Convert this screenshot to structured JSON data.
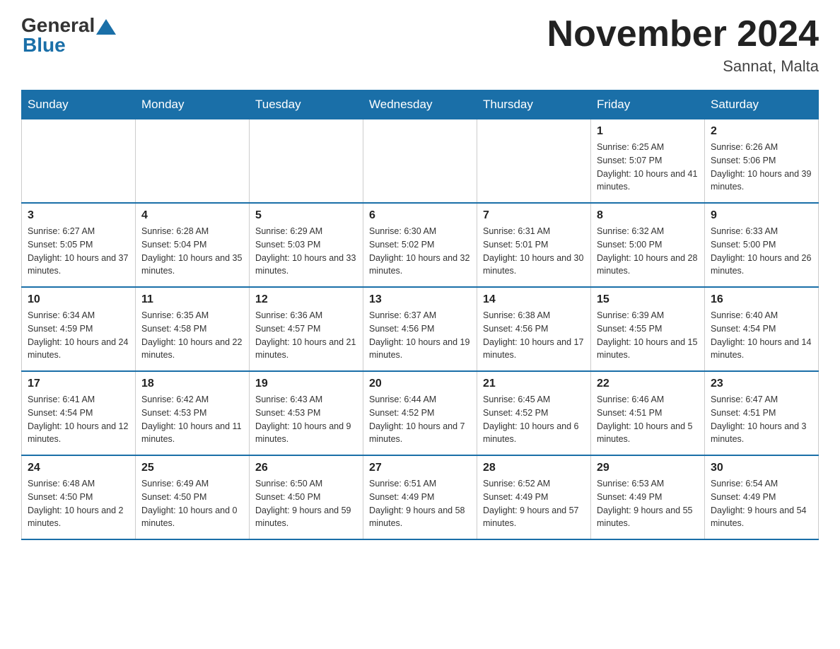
{
  "header": {
    "logo_general": "General",
    "logo_blue": "Blue",
    "title": "November 2024",
    "subtitle": "Sannat, Malta"
  },
  "days_of_week": [
    "Sunday",
    "Monday",
    "Tuesday",
    "Wednesday",
    "Thursday",
    "Friday",
    "Saturday"
  ],
  "weeks": [
    [
      {
        "day": "",
        "info": ""
      },
      {
        "day": "",
        "info": ""
      },
      {
        "day": "",
        "info": ""
      },
      {
        "day": "",
        "info": ""
      },
      {
        "day": "",
        "info": ""
      },
      {
        "day": "1",
        "info": "Sunrise: 6:25 AM\nSunset: 5:07 PM\nDaylight: 10 hours and 41 minutes."
      },
      {
        "day": "2",
        "info": "Sunrise: 6:26 AM\nSunset: 5:06 PM\nDaylight: 10 hours and 39 minutes."
      }
    ],
    [
      {
        "day": "3",
        "info": "Sunrise: 6:27 AM\nSunset: 5:05 PM\nDaylight: 10 hours and 37 minutes."
      },
      {
        "day": "4",
        "info": "Sunrise: 6:28 AM\nSunset: 5:04 PM\nDaylight: 10 hours and 35 minutes."
      },
      {
        "day": "5",
        "info": "Sunrise: 6:29 AM\nSunset: 5:03 PM\nDaylight: 10 hours and 33 minutes."
      },
      {
        "day": "6",
        "info": "Sunrise: 6:30 AM\nSunset: 5:02 PM\nDaylight: 10 hours and 32 minutes."
      },
      {
        "day": "7",
        "info": "Sunrise: 6:31 AM\nSunset: 5:01 PM\nDaylight: 10 hours and 30 minutes."
      },
      {
        "day": "8",
        "info": "Sunrise: 6:32 AM\nSunset: 5:00 PM\nDaylight: 10 hours and 28 minutes."
      },
      {
        "day": "9",
        "info": "Sunrise: 6:33 AM\nSunset: 5:00 PM\nDaylight: 10 hours and 26 minutes."
      }
    ],
    [
      {
        "day": "10",
        "info": "Sunrise: 6:34 AM\nSunset: 4:59 PM\nDaylight: 10 hours and 24 minutes."
      },
      {
        "day": "11",
        "info": "Sunrise: 6:35 AM\nSunset: 4:58 PM\nDaylight: 10 hours and 22 minutes."
      },
      {
        "day": "12",
        "info": "Sunrise: 6:36 AM\nSunset: 4:57 PM\nDaylight: 10 hours and 21 minutes."
      },
      {
        "day": "13",
        "info": "Sunrise: 6:37 AM\nSunset: 4:56 PM\nDaylight: 10 hours and 19 minutes."
      },
      {
        "day": "14",
        "info": "Sunrise: 6:38 AM\nSunset: 4:56 PM\nDaylight: 10 hours and 17 minutes."
      },
      {
        "day": "15",
        "info": "Sunrise: 6:39 AM\nSunset: 4:55 PM\nDaylight: 10 hours and 15 minutes."
      },
      {
        "day": "16",
        "info": "Sunrise: 6:40 AM\nSunset: 4:54 PM\nDaylight: 10 hours and 14 minutes."
      }
    ],
    [
      {
        "day": "17",
        "info": "Sunrise: 6:41 AM\nSunset: 4:54 PM\nDaylight: 10 hours and 12 minutes."
      },
      {
        "day": "18",
        "info": "Sunrise: 6:42 AM\nSunset: 4:53 PM\nDaylight: 10 hours and 11 minutes."
      },
      {
        "day": "19",
        "info": "Sunrise: 6:43 AM\nSunset: 4:53 PM\nDaylight: 10 hours and 9 minutes."
      },
      {
        "day": "20",
        "info": "Sunrise: 6:44 AM\nSunset: 4:52 PM\nDaylight: 10 hours and 7 minutes."
      },
      {
        "day": "21",
        "info": "Sunrise: 6:45 AM\nSunset: 4:52 PM\nDaylight: 10 hours and 6 minutes."
      },
      {
        "day": "22",
        "info": "Sunrise: 6:46 AM\nSunset: 4:51 PM\nDaylight: 10 hours and 5 minutes."
      },
      {
        "day": "23",
        "info": "Sunrise: 6:47 AM\nSunset: 4:51 PM\nDaylight: 10 hours and 3 minutes."
      }
    ],
    [
      {
        "day": "24",
        "info": "Sunrise: 6:48 AM\nSunset: 4:50 PM\nDaylight: 10 hours and 2 minutes."
      },
      {
        "day": "25",
        "info": "Sunrise: 6:49 AM\nSunset: 4:50 PM\nDaylight: 10 hours and 0 minutes."
      },
      {
        "day": "26",
        "info": "Sunrise: 6:50 AM\nSunset: 4:50 PM\nDaylight: 9 hours and 59 minutes."
      },
      {
        "day": "27",
        "info": "Sunrise: 6:51 AM\nSunset: 4:49 PM\nDaylight: 9 hours and 58 minutes."
      },
      {
        "day": "28",
        "info": "Sunrise: 6:52 AM\nSunset: 4:49 PM\nDaylight: 9 hours and 57 minutes."
      },
      {
        "day": "29",
        "info": "Sunrise: 6:53 AM\nSunset: 4:49 PM\nDaylight: 9 hours and 55 minutes."
      },
      {
        "day": "30",
        "info": "Sunrise: 6:54 AM\nSunset: 4:49 PM\nDaylight: 9 hours and 54 minutes."
      }
    ]
  ]
}
